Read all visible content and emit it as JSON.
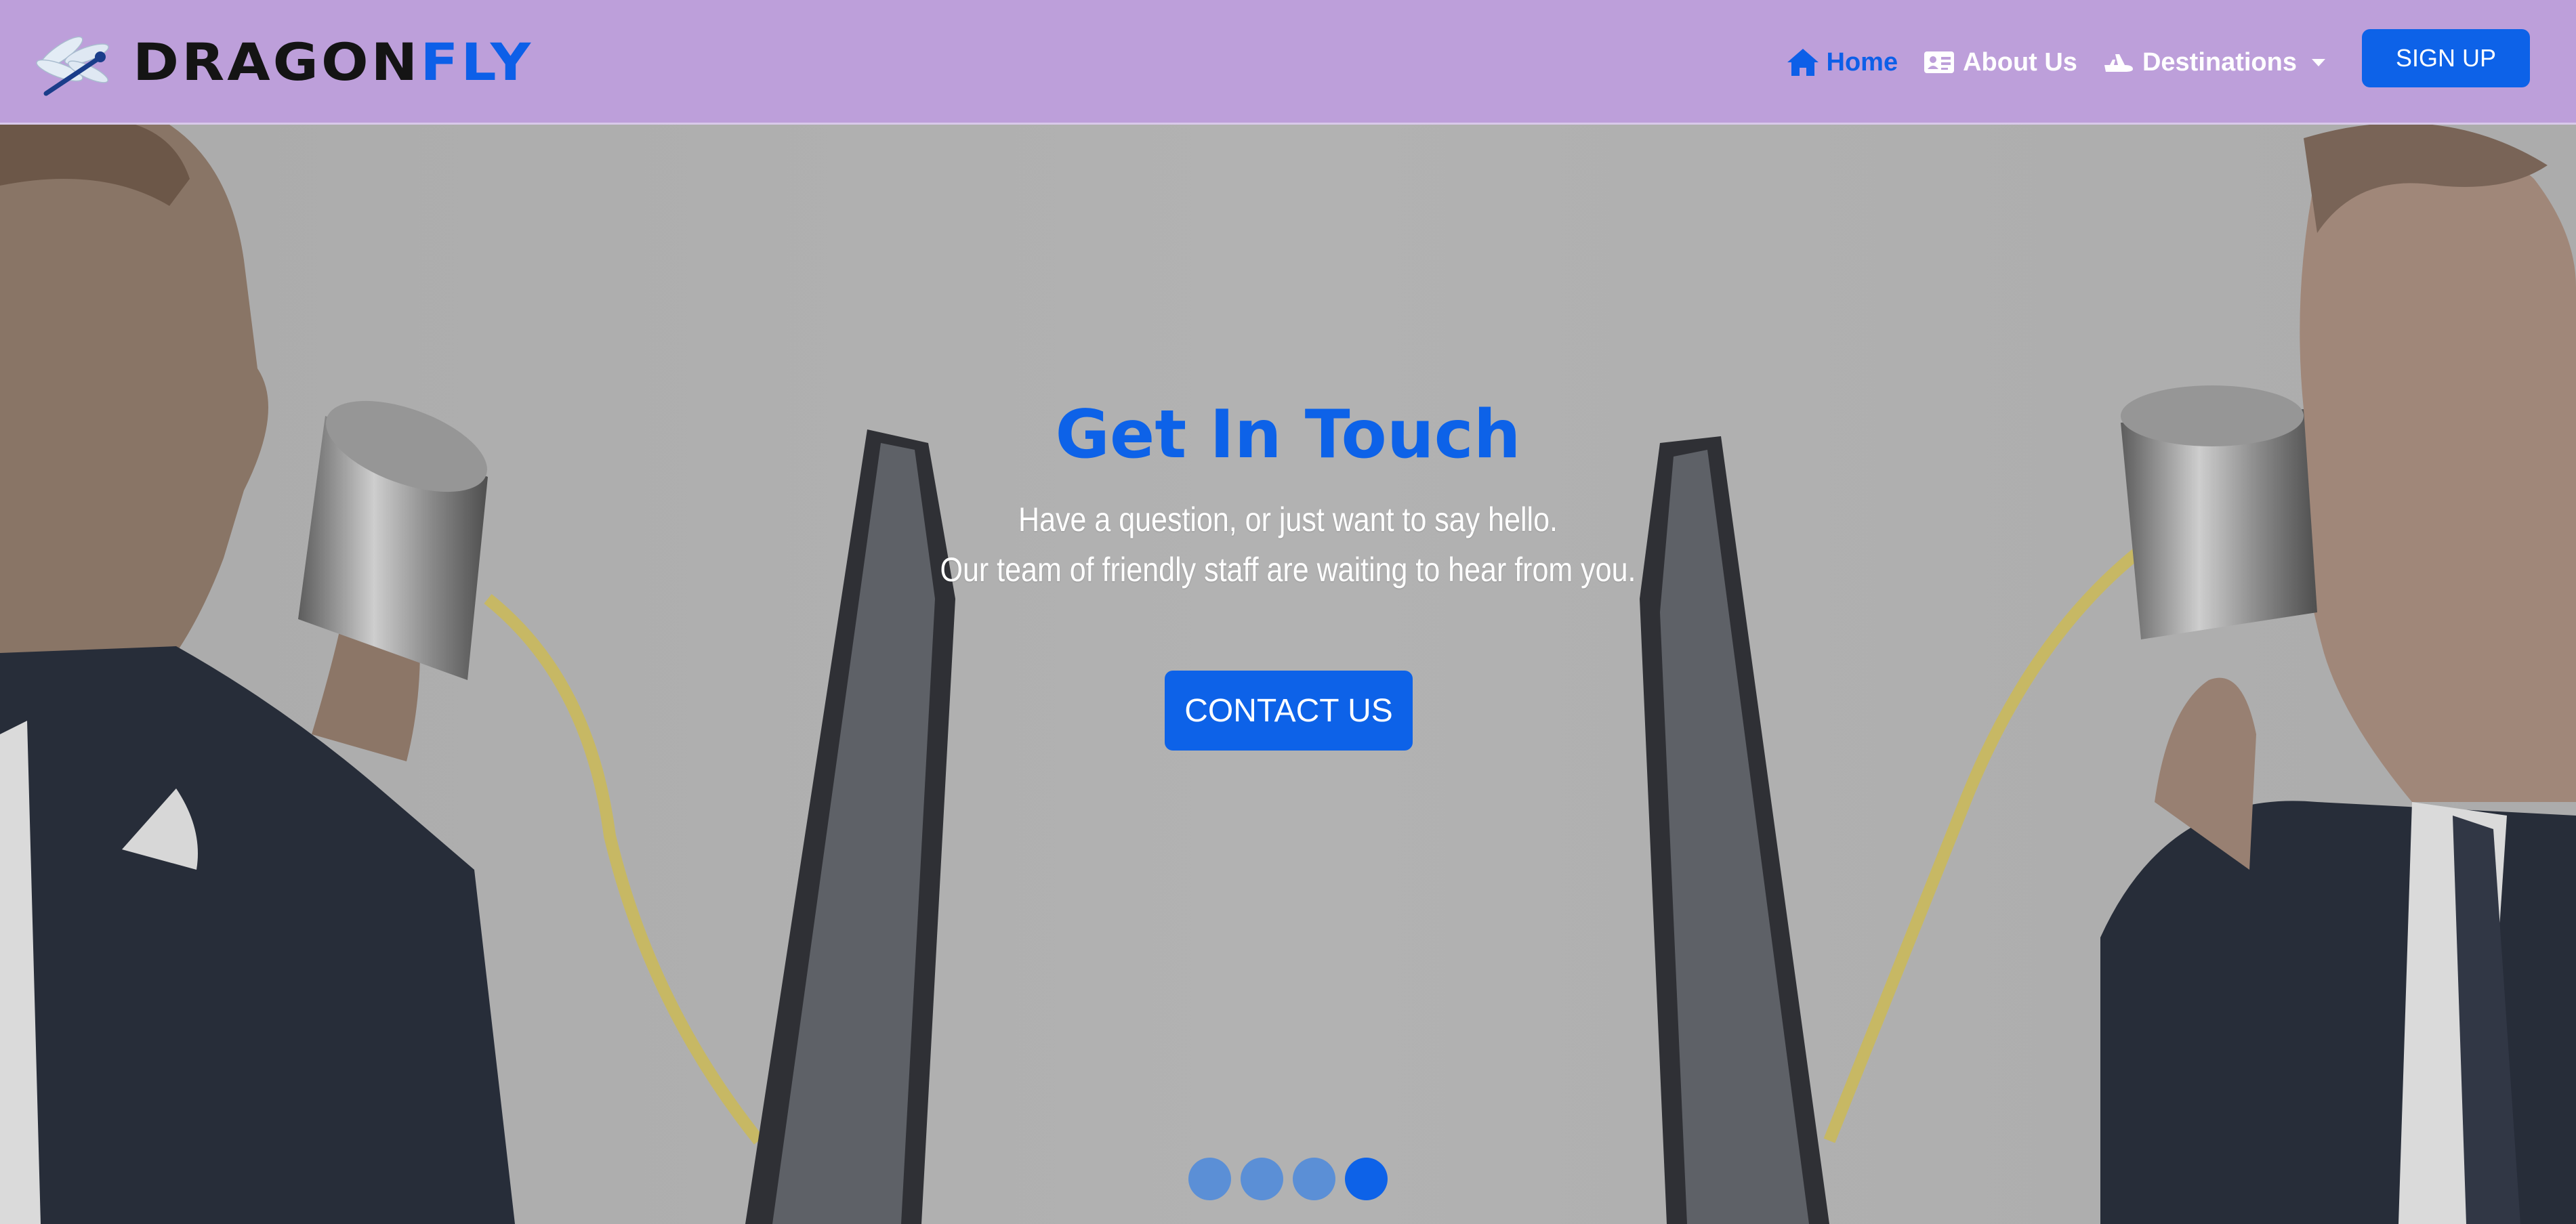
{
  "brand": {
    "logo_icon": "dragonfly-logo",
    "name_part1": "DRAGON",
    "name_part2": "FLY"
  },
  "nav": {
    "items": [
      {
        "label": "Home",
        "icon": "home-icon",
        "active": true
      },
      {
        "label": "About Us",
        "icon": "id-card-icon",
        "active": false
      },
      {
        "label": "Destinations",
        "icon": "plane-icon",
        "active": false,
        "dropdown": true
      }
    ],
    "signup_label": "SIGN UP"
  },
  "hero": {
    "title": "Get In Touch",
    "subtitle_line1": "Have a question, or just want to say hello.",
    "subtitle_line2": "Our team of friendly staff are waiting to hear from you.",
    "cta_label": "CONTACT US",
    "background": "two men talking through tin-can telephone between computer monitors"
  },
  "carousel": {
    "slide_count": 4,
    "active_index": 3
  },
  "colors": {
    "navbar_bg": "#bd9fda",
    "accent": "#0d62e8",
    "brand_dark": "#141414",
    "indicator_inactive": "#5b8fd6"
  }
}
